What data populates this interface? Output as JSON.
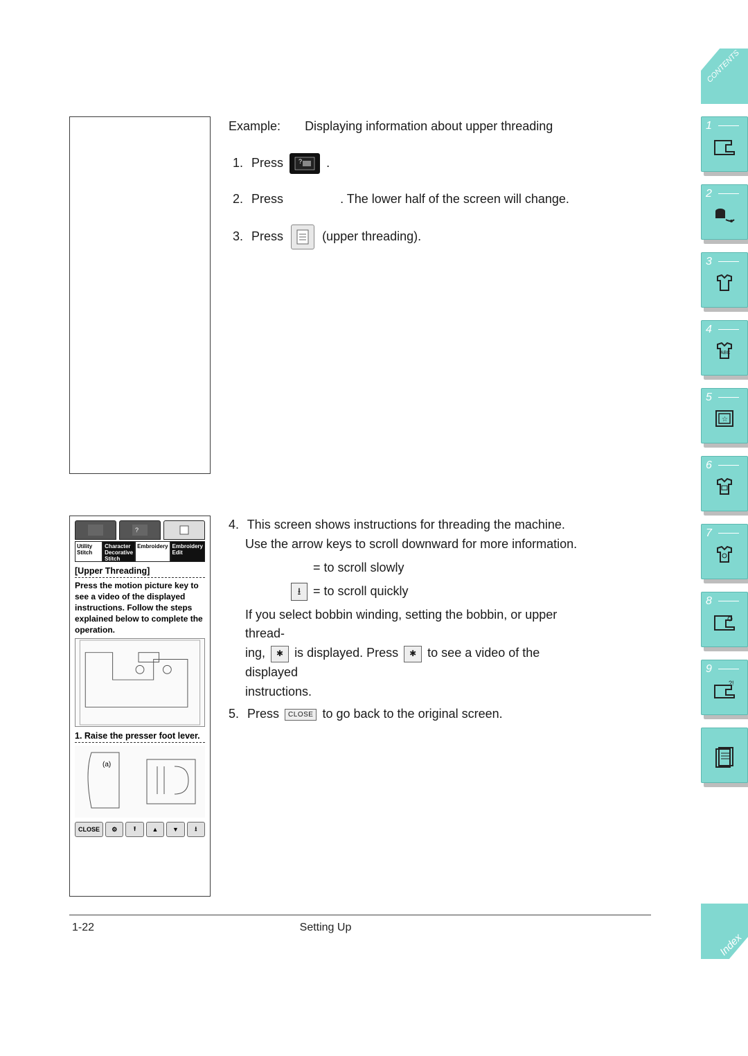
{
  "example": {
    "label": "Example:",
    "description": "Displaying information about upper threading"
  },
  "steps": {
    "s1": {
      "num": "1.",
      "press": "Press",
      "period": "."
    },
    "s2": {
      "num": "2.",
      "press": "Press",
      "tail": ". The lower half of the screen will change."
    },
    "s3": {
      "num": "3.",
      "press": "Press",
      "tail": "(upper threading)."
    },
    "s4": {
      "num": "4.",
      "line1": "This screen shows instructions for threading the machine.",
      "line2": "Use the arrow keys to scroll downward for more information.",
      "scroll_slow": "= to scroll slowly",
      "scroll_fast": "= to scroll quickly",
      "para_a": "If you select bobbin winding, setting the bobbin, or upper thread-",
      "para_b_pre": "ing,",
      "para_b_mid": "is displayed. Press",
      "para_b_post": "to see a video of the displayed",
      "para_c": "instructions."
    },
    "s5": {
      "num": "5.",
      "press": "Press",
      "tail": "to go back to the original screen.",
      "close_label": "CLOSE"
    }
  },
  "screen": {
    "cats": [
      "Utility Stitch",
      "Character Decorative Stitch",
      "Embroidery",
      "Embroidery Edit"
    ],
    "title": "[Upper Threading]",
    "instr": "Press the motion picture key to see a video of the displayed instructions. Follow the steps explained below to complete the operation.",
    "step1": "1. Raise the presser foot lever.",
    "bottom": {
      "close": "CLOSE",
      "video": "⚙",
      "up2": "⭱",
      "up": "▲",
      "down": "▼",
      "down2": "⭳"
    }
  },
  "tabs": {
    "contents": "CONTENTS",
    "nums": [
      "1",
      "2",
      "3",
      "4",
      "5",
      "6",
      "7",
      "8",
      "9"
    ],
    "index": "Index"
  },
  "footer": {
    "page": "1-22",
    "section": "Setting Up"
  }
}
